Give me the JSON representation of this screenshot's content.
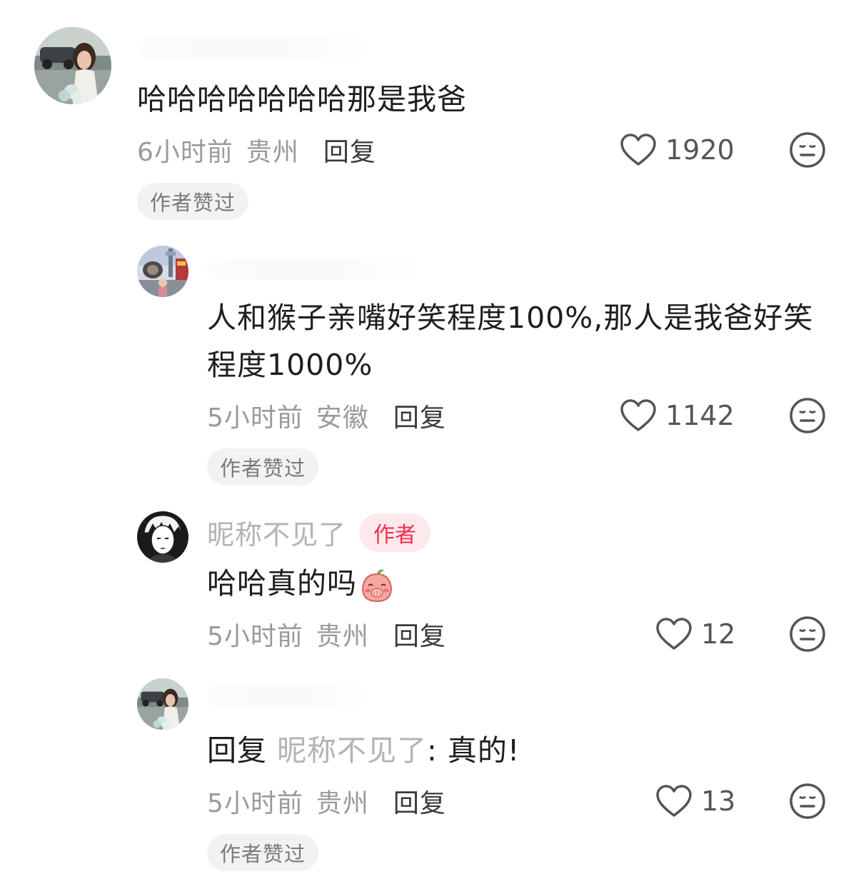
{
  "comments": [
    {
      "text": "哈哈哈哈哈哈哈那是我爸",
      "time": "6小时前",
      "location": "贵州",
      "reply_label": "回复",
      "likes": "1920",
      "badge": "作者赞过",
      "avatar_icon": "avatar-woman-with-flowers"
    },
    {
      "text_line1": "人和猴子亲嘴好笑程度100%,那人是我爸好笑",
      "text_line2": "程度1000%",
      "time": "5小时前",
      "location": "安徽",
      "reply_label": "回复",
      "likes": "1142",
      "badge": "作者赞过",
      "avatar_icon": "avatar-city-street"
    },
    {
      "nickname": "昵称不见了",
      "author_tag": "作者",
      "text": "哈哈真的吗",
      "emoji_icon": "peach-shy-emoji",
      "time": "5小时前",
      "location": "贵州",
      "reply_label": "回复",
      "likes": "12",
      "avatar_icon": "avatar-manga-boy"
    },
    {
      "reply_prefix": "回复 ",
      "reply_target": "昵称不见了",
      "reply_text": ": 真的!",
      "time": "5小时前",
      "location": "贵州",
      "reply_label": "回复",
      "likes": "13",
      "badge": "作者赞过",
      "avatar_icon": "avatar-woman-with-flowers"
    }
  ],
  "colors": {
    "author_tag_bg": "#fde8ec",
    "author_tag_text": "#f0304f",
    "meta_text": "#9a9a9a",
    "badge_bg": "#f2f2f2"
  }
}
